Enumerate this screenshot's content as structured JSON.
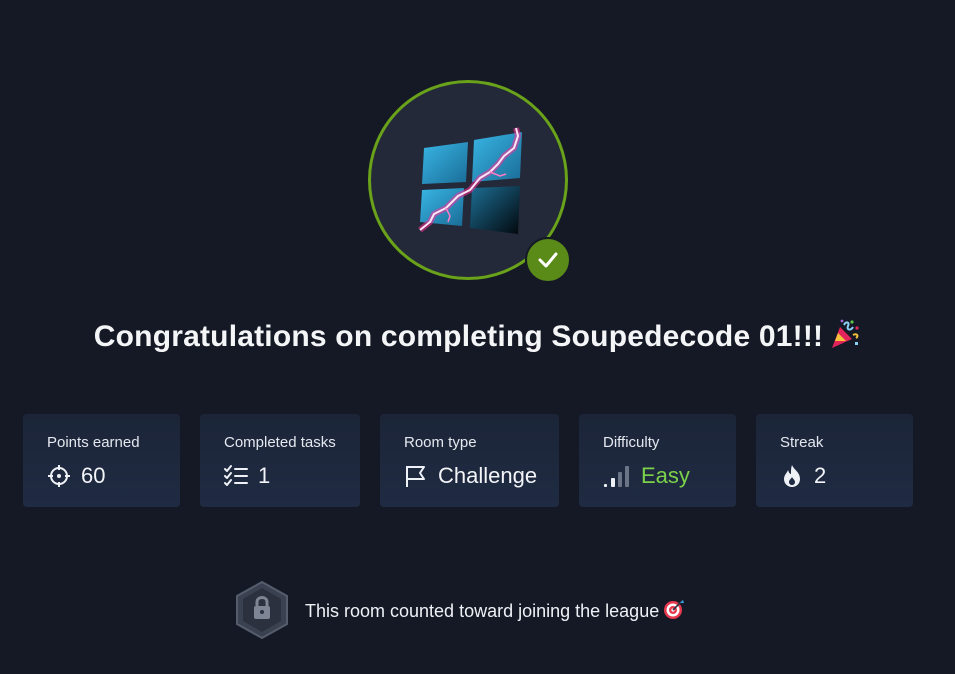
{
  "room": {
    "logo_icon": "shattered-windows-logo",
    "completed_icon": "check-icon",
    "accent_color": "#6aa21a"
  },
  "title": {
    "text": "Congratulations on completing Soupedecode 01!!!",
    "emoji_icon": "party-popper-icon"
  },
  "stats": [
    {
      "label": "Points earned",
      "value": "60",
      "icon": "crosshair-icon"
    },
    {
      "label": "Completed tasks",
      "value": "1",
      "icon": "checklist-icon"
    },
    {
      "label": "Room type",
      "value": "Challenge",
      "icon": "flag-icon"
    },
    {
      "label": "Difficulty",
      "value": "Easy",
      "icon": "signal-bars-icon",
      "color": "#7bd24a"
    },
    {
      "label": "Streak",
      "value": "2",
      "icon": "flame-icon"
    }
  ],
  "league": {
    "text": "This room counted toward joining the league",
    "badge_icon": "locked-league-badge-icon",
    "emoji_icon": "target-icon"
  }
}
